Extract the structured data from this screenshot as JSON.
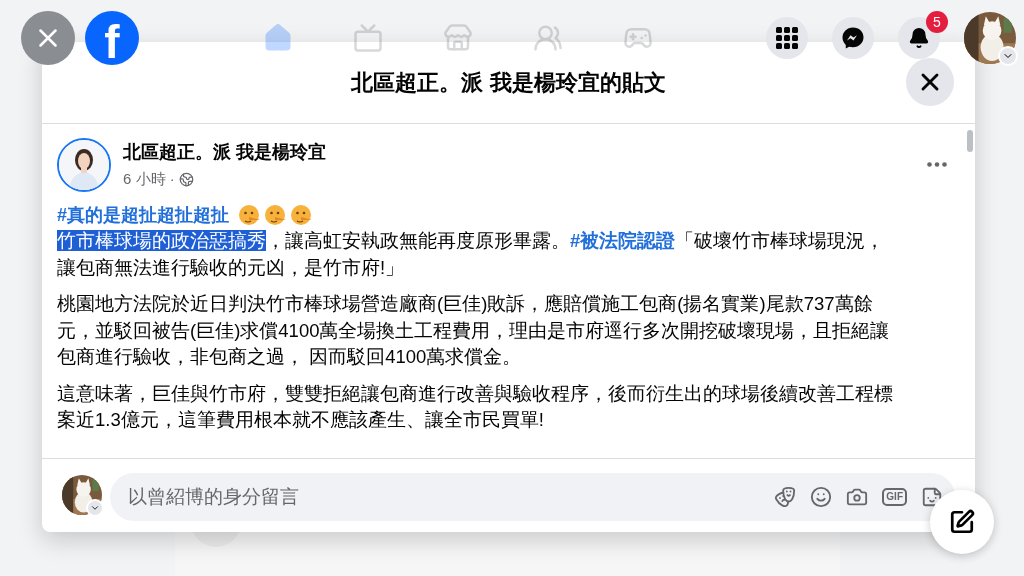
{
  "top_bar": {
    "logo_text": "f",
    "nav": [
      {
        "kind": "home",
        "selected": true
      },
      {
        "kind": "video",
        "selected": false
      },
      {
        "kind": "store",
        "selected": false
      },
      {
        "kind": "groups",
        "selected": false
      },
      {
        "kind": "gaming",
        "selected": false
      }
    ],
    "notification_count": "5"
  },
  "dialog": {
    "title": "北區超正。派 我是楊玲宜的貼文"
  },
  "post": {
    "author": "北區超正。派 我是楊玲宜",
    "time": "6 小時 ·",
    "hashtag_line": {
      "text": "#真的是超扯超扯超扯",
      "emojis": [
        {
          "kind": "lying-face"
        },
        {
          "kind": "lying-face"
        },
        {
          "kind": "lying-face"
        }
      ]
    },
    "paragraphs": [
      [
        [
          {
            "kind": "highlight",
            "text": "竹市棒球場的政治惡搞秀"
          },
          {
            "kind": "text",
            "text": "，讓高虹安執政無能再度原形畢露。"
          },
          {
            "kind": "hashtag",
            "text": "#被法院認證"
          },
          {
            "kind": "text",
            "text": "「破壞竹市棒球場現況，"
          }
        ],
        [
          {
            "kind": "text",
            "text": "讓包商無法進行驗收的元凶，是竹市府!」"
          }
        ]
      ],
      [
        [
          {
            "kind": "text",
            "text": "桃園地方法院於近日判決竹市棒球場營造廠商(巨佳)敗訴，應賠償施工包商(揚名實業)尾款737萬餘"
          }
        ],
        [
          {
            "kind": "text",
            "text": "元，並駁回被告(巨佳)求償4100萬全場換土工程費用，理由是市府逕行多次開挖破壞現場，且拒絕讓"
          }
        ],
        [
          {
            "kind": "text",
            "text": "包商進行驗收，非包商之過， 因而駁回4100萬求償金。"
          }
        ]
      ],
      [
        [
          {
            "kind": "text",
            "text": "這意味著，巨佳與竹市府，雙雙拒絕讓包商進行改善與驗收程序，後而衍生出的球場後續改善工程標"
          }
        ],
        [
          {
            "kind": "text",
            "text": "案近1.3億元，這筆費用根本就不應該產生、讓全市民買單!"
          }
        ]
      ]
    ]
  },
  "comment": {
    "placeholder": "以曾紹博的身分留言",
    "gif_label": "GIF"
  }
}
